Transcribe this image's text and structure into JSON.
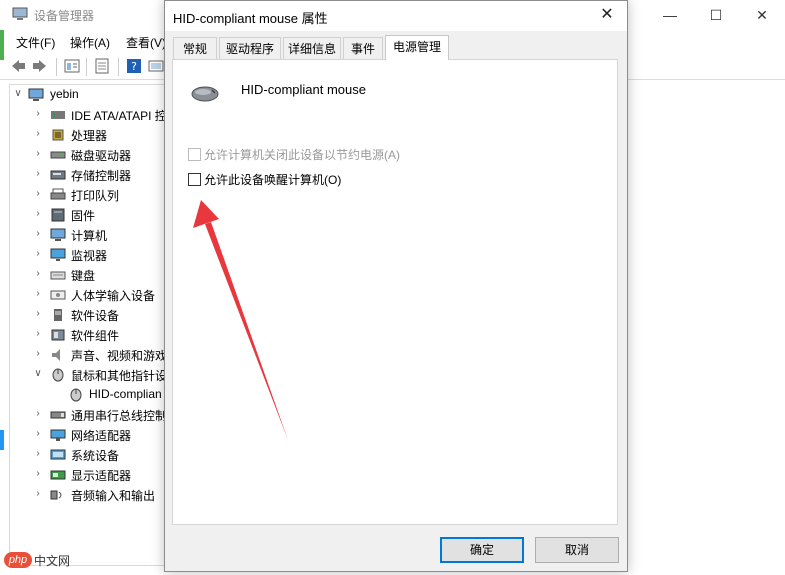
{
  "device_manager": {
    "title": "设备管理器",
    "menu": [
      "文件(F)",
      "操作(A)",
      "查看(V)"
    ],
    "window_buttons": [
      "—",
      "☐",
      "✕"
    ],
    "tree": {
      "root": "yebin",
      "items": [
        {
          "label": "IDE ATA/ATAPI 控",
          "icon": "ide-controller-icon",
          "expanded": false
        },
        {
          "label": "处理器",
          "icon": "processor-icon",
          "expanded": false
        },
        {
          "label": "磁盘驱动器",
          "icon": "disk-drive-icon",
          "expanded": false
        },
        {
          "label": "存储控制器",
          "icon": "storage-controller-icon",
          "expanded": false
        },
        {
          "label": "打印队列",
          "icon": "print-queue-icon",
          "expanded": false
        },
        {
          "label": "固件",
          "icon": "firmware-icon",
          "expanded": false
        },
        {
          "label": "计算机",
          "icon": "computer-icon",
          "expanded": false
        },
        {
          "label": "监视器",
          "icon": "monitor-icon",
          "expanded": false
        },
        {
          "label": "键盘",
          "icon": "keyboard-icon",
          "expanded": false
        },
        {
          "label": "人体学输入设备",
          "icon": "hid-icon",
          "expanded": false
        },
        {
          "label": "软件设备",
          "icon": "software-device-icon",
          "expanded": false
        },
        {
          "label": "软件组件",
          "icon": "software-component-icon",
          "expanded": false
        },
        {
          "label": "声音、视频和游戏",
          "icon": "sound-icon",
          "expanded": false
        },
        {
          "label": "鼠标和其他指针设",
          "icon": "mouse-icon",
          "expanded": true
        },
        {
          "label": "HID-complian",
          "icon": "mouse-device-icon",
          "child": true
        },
        {
          "label": "通用串行总线控制",
          "icon": "usb-icon",
          "expanded": false
        },
        {
          "label": "网络适配器",
          "icon": "network-adapter-icon",
          "expanded": false
        },
        {
          "label": "系统设备",
          "icon": "system-device-icon",
          "expanded": false
        },
        {
          "label": "显示适配器",
          "icon": "display-adapter-icon",
          "expanded": false
        },
        {
          "label": "音频输入和输出",
          "icon": "audio-io-icon",
          "expanded": false
        }
      ]
    }
  },
  "dialog": {
    "title": "HID-compliant mouse 属性",
    "close": "✕",
    "tabs": [
      "常规",
      "驱动程序",
      "详细信息",
      "事件",
      "电源管理"
    ],
    "active_tab": 4,
    "device_name": "HID-compliant mouse",
    "options": [
      {
        "label": "允许计算机关闭此设备以节约电源(A)",
        "checked": false,
        "disabled": true
      },
      {
        "label": "允许此设备唤醒计算机(O)",
        "checked": false,
        "disabled": false
      }
    ],
    "ok_label": "确定",
    "cancel_label": "取消"
  },
  "watermark": {
    "logo": "php",
    "text": "中文网"
  },
  "colors": {
    "accent": "#0078d7",
    "arrow": "#e8383d"
  }
}
